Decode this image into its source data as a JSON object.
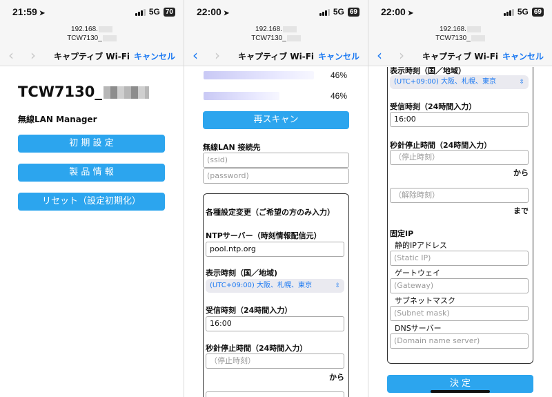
{
  "screens": [
    {
      "status": {
        "time": "21:59",
        "network": "5G",
        "battery": "70"
      },
      "url": {
        "line1": "192.168.",
        "line2": "TCW7130_"
      },
      "nav": {
        "back": "‹",
        "forward": "›",
        "title": "キャプティブ Wi-Fi",
        "cancel": "キャンセル"
      },
      "device_title": "TCW7130_",
      "manager_label": "無線LAN Manager",
      "buttons": {
        "initial_setup": "初 期 設 定",
        "product_info": "製 品 情 報",
        "reset": "リセット（設定初期化）"
      }
    },
    {
      "status": {
        "time": "22:00",
        "network": "5G",
        "battery": "69"
      },
      "url": {
        "line1": "192.168.",
        "line2": "TCW7130_"
      },
      "nav": {
        "back": "‹",
        "forward": "›",
        "title": "キャプティブ Wi-Fi",
        "cancel": "キャンセル"
      },
      "networks": [
        {
          "signal": "46%"
        },
        {
          "signal": "46%"
        }
      ],
      "rescan_label": "再スキャン",
      "connect_title": "無線LAN 接続先",
      "ssid_placeholder": "(ssid)",
      "password_placeholder": "(password)",
      "settings_title": "各種設定変更（ご希望の方のみ入力）",
      "ntp_label": "NTPサーバー（時刻情報配信元）",
      "ntp_value": "pool.ntp.org",
      "tz_label": "表示時刻（国／地域)",
      "tz_value": "(UTC+09:00) 大阪、札幌、東京",
      "receive_label": "受信時刻（24時間入力）",
      "receive_value": "16:00",
      "stop_label": "秒針停止時間（24時間入力）",
      "stop_placeholder": "（停止時刻）",
      "from_label": "から"
    },
    {
      "status": {
        "time": "22:00",
        "network": "5G",
        "battery": "69"
      },
      "url": {
        "line1": "192.168.",
        "line2": "TCW7130_"
      },
      "nav": {
        "back": "‹",
        "forward": "›",
        "title": "キャプティブ Wi-Fi",
        "cancel": "キャンセル"
      },
      "tz_label": "表示時刻（国／地域）",
      "tz_value": "(UTC+09:00) 大阪、札幌、東京",
      "receive_label": "受信時刻（24時間入力）",
      "receive_value": "16:00",
      "stop_label": "秒針停止時間（24時間入力）",
      "stop_placeholder": "（停止時刻）",
      "from_label": "から",
      "release_placeholder": "（解除時刻）",
      "until_label": "まで",
      "fixed_ip_title": "固定IP",
      "static_ip_label": "静的IPアドレス",
      "static_ip_placeholder": "(Static IP)",
      "gateway_label": "ゲートウェイ",
      "gateway_placeholder": "(Gateway)",
      "subnet_label": "サブネットマスク",
      "subnet_placeholder": "(Subnet mask)",
      "dns_label": "DNSサーバー",
      "dns_placeholder": "(Domain name server)",
      "submit_label": "決 定"
    }
  ],
  "colors": {
    "accent": "#2ca5ee",
    "link": "#1877f2"
  }
}
